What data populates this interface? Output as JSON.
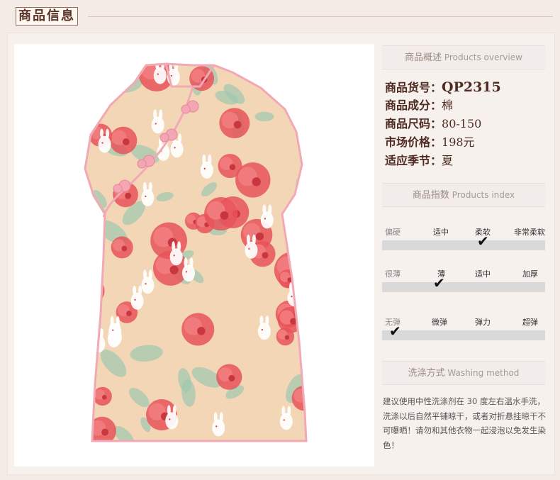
{
  "header": {
    "title": "商品信息"
  },
  "overview": {
    "title_zh": "商品概述",
    "title_en": "Products overview",
    "rows": [
      {
        "key": "商品货号：",
        "value": "QP2315"
      },
      {
        "key": "商品成分：",
        "value": "棉"
      },
      {
        "key": "商品尺码：",
        "value": "80-150"
      },
      {
        "key": "市场价格：",
        "value": "198元"
      },
      {
        "key": "适应季节：",
        "value": "夏"
      }
    ]
  },
  "index": {
    "title_zh": "商品指数",
    "title_en": "Products index",
    "scales": [
      {
        "labels": [
          "偏硬",
          "适中",
          "柔软",
          "非常柔软"
        ],
        "selected": 2
      },
      {
        "labels": [
          "很薄",
          "薄",
          "适中",
          "加厚"
        ],
        "selected": 1
      },
      {
        "labels": [
          "无弹",
          "微弹",
          "弹力",
          "超弹"
        ],
        "selected": 0
      }
    ],
    "check_glyph": "✔"
  },
  "washing": {
    "title_zh": "洗涤方式",
    "title_en": "Washing method",
    "text": "建议使用中性洗涤剂在 30 度左右温水手洗，洗涤以后自然平铺晾干，或者对折悬挂晾干不可曝晒！请勿和其他衣物一起浸泡以免发生染色！"
  },
  "product_image": {
    "subject": "qipao-dress-icon",
    "colors": {
      "base": "#f2d4b4",
      "flower": "#e8545a",
      "leaf": "#9ec7b0",
      "piping": "#f2a9b6"
    }
  }
}
